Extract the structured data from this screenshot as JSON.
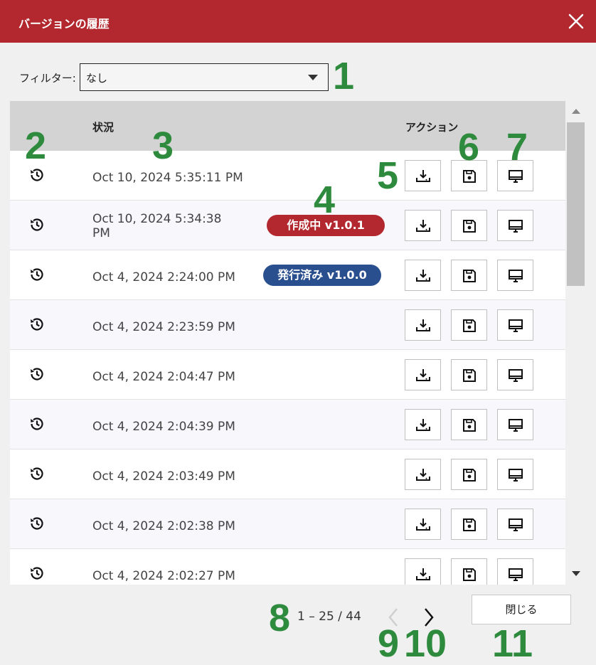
{
  "window": {
    "title": "バージョンの履歴"
  },
  "filter": {
    "label": "フィルター:",
    "value": "なし"
  },
  "table": {
    "columns": {
      "status": "状況",
      "action": "アクション"
    },
    "rows": [
      {
        "date": "Oct 10, 2024 5:35:11 PM",
        "badge": ""
      },
      {
        "date": "Oct 10, 2024 5:34:38 PM",
        "badge": "作成中 v1.0.1"
      },
      {
        "date": "Oct 4, 2024 2:24:00 PM",
        "badge": "発行済み v1.0.0"
      },
      {
        "date": "Oct 4, 2024 2:23:59 PM",
        "badge": ""
      },
      {
        "date": "Oct 4, 2024 2:04:47 PM",
        "badge": ""
      },
      {
        "date": "Oct 4, 2024 2:04:39 PM",
        "badge": ""
      },
      {
        "date": "Oct 4, 2024 2:03:49 PM",
        "badge": ""
      },
      {
        "date": "Oct 4, 2024 2:02:38 PM",
        "badge": ""
      },
      {
        "date": "Oct 4, 2024 2:02:27 PM",
        "badge": ""
      }
    ]
  },
  "pagination": {
    "range": "1 – 25 / 44"
  },
  "footer": {
    "close_label": "閉じる"
  },
  "annotations": [
    "1",
    "2",
    "3",
    "4",
    "5",
    "6",
    "7",
    "8",
    "9",
    "10",
    "11"
  ],
  "colors": {
    "titlebar": "#b2282e",
    "draft_badge": "#b2282e",
    "published_badge": "#2a4f8f",
    "annotation": "#2e8b3e"
  },
  "icons": {
    "history": "history-icon",
    "download": "download-icon",
    "save": "save-icon",
    "preview": "monitor-icon",
    "close": "close-icon"
  }
}
